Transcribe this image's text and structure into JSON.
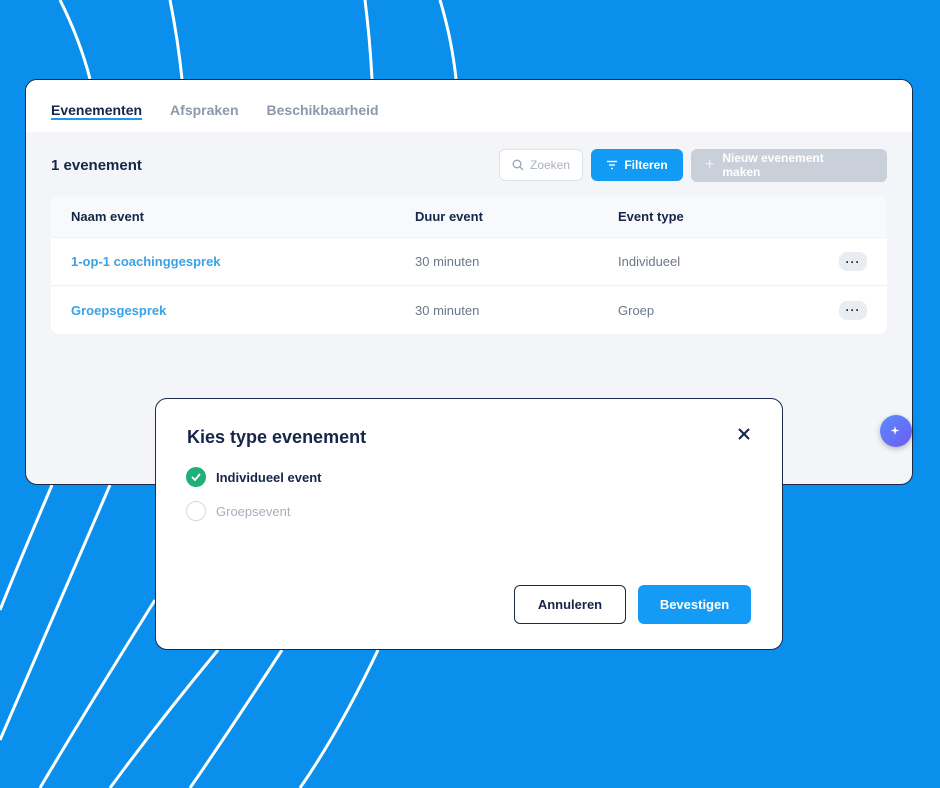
{
  "colors": {
    "background": "#0a8fec",
    "accent": "#129bf5",
    "link": "#3aa2e6",
    "text_dark": "#16254a",
    "success": "#1fb07a",
    "disabled": "#c9d0d9"
  },
  "tabs": [
    {
      "label": "Evenementen",
      "active": true
    },
    {
      "label": "Afspraken",
      "active": false
    },
    {
      "label": "Beschikbaarheid",
      "active": false
    }
  ],
  "toolbar": {
    "count_label": "1 evenement",
    "search_placeholder": "Zoeken",
    "search_icon": "search-icon",
    "filter_label": "Filteren",
    "filter_icon": "filter-icon",
    "new_label": "Nieuw evenement maken",
    "new_icon": "plus-icon"
  },
  "table": {
    "headers": [
      "Naam event",
      "Duur event",
      "Event type"
    ],
    "rows": [
      {
        "name": "1-op-1 coachinggesprek",
        "duration": "30 minuten",
        "type": "Individueel",
        "menu": "···"
      },
      {
        "name": "Groepsgesprek",
        "duration": "30 minuten",
        "type": "Groep",
        "menu": "···"
      }
    ]
  },
  "assistant_icon": "sparkle-icon",
  "modal": {
    "title": "Kies type evenement",
    "close_icon": "close-icon",
    "options": [
      {
        "label": "Individueel event",
        "checked": true
      },
      {
        "label": "Groepsevent",
        "checked": false
      }
    ],
    "cancel_label": "Annuleren",
    "confirm_label": "Bevestigen"
  }
}
